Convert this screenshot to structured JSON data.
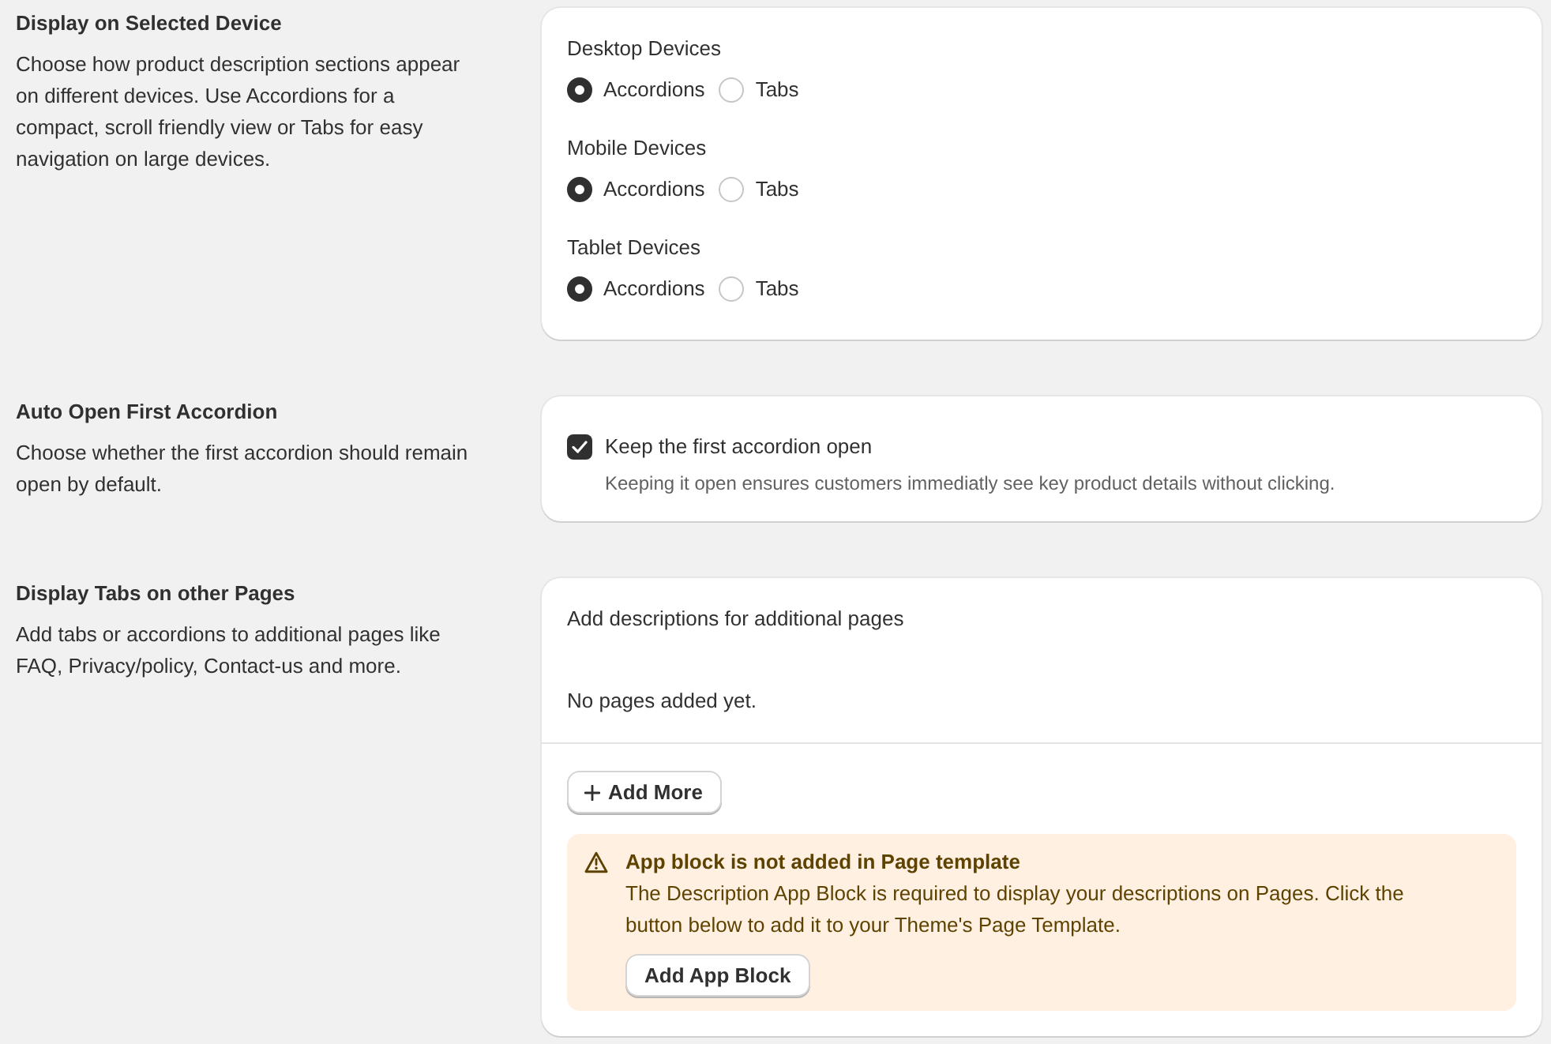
{
  "sections": [
    {
      "title": "Display on Selected Device",
      "description": "Choose how product description sections appear on different devices. Use Accordions for a compact, scroll friendly view or Tabs for easy navigation on large devices.",
      "card": {
        "kind": "radio_groups",
        "groups": [
          {
            "label": "Desktop Devices",
            "options": [
              {
                "label": "Accordions",
                "selected": true
              },
              {
                "label": "Tabs",
                "selected": false
              }
            ]
          },
          {
            "label": "Mobile Devices",
            "options": [
              {
                "label": "Accordions",
                "selected": true
              },
              {
                "label": "Tabs",
                "selected": false
              }
            ]
          },
          {
            "label": "Tablet Devices",
            "options": [
              {
                "label": "Accordions",
                "selected": true
              },
              {
                "label": "Tabs",
                "selected": false
              }
            ]
          }
        ]
      }
    },
    {
      "title": "Auto Open First Accordion",
      "description": "Choose whether the first accordion should remain open by default.",
      "card": {
        "kind": "checkbox",
        "label": "Keep the first accordion open",
        "checked": true,
        "help": "Keeping it open ensures customers immediatly see key product details without clicking."
      }
    },
    {
      "title": "Display Tabs on other Pages",
      "description": "Add tabs or accordions to additional pages like FAQ, Privacy/policy, Contact-us and more.",
      "card": {
        "kind": "pages",
        "heading": "Add descriptions for additional pages",
        "empty_text": "No pages added yet.",
        "add_button": "Add More",
        "banner": {
          "title": "App block is not added in Page template",
          "message": "The Description App Block is required to display your descriptions on Pages. Click the button below to add it to your Theme's Page Template.",
          "button": "Add App Block"
        }
      }
    }
  ]
}
